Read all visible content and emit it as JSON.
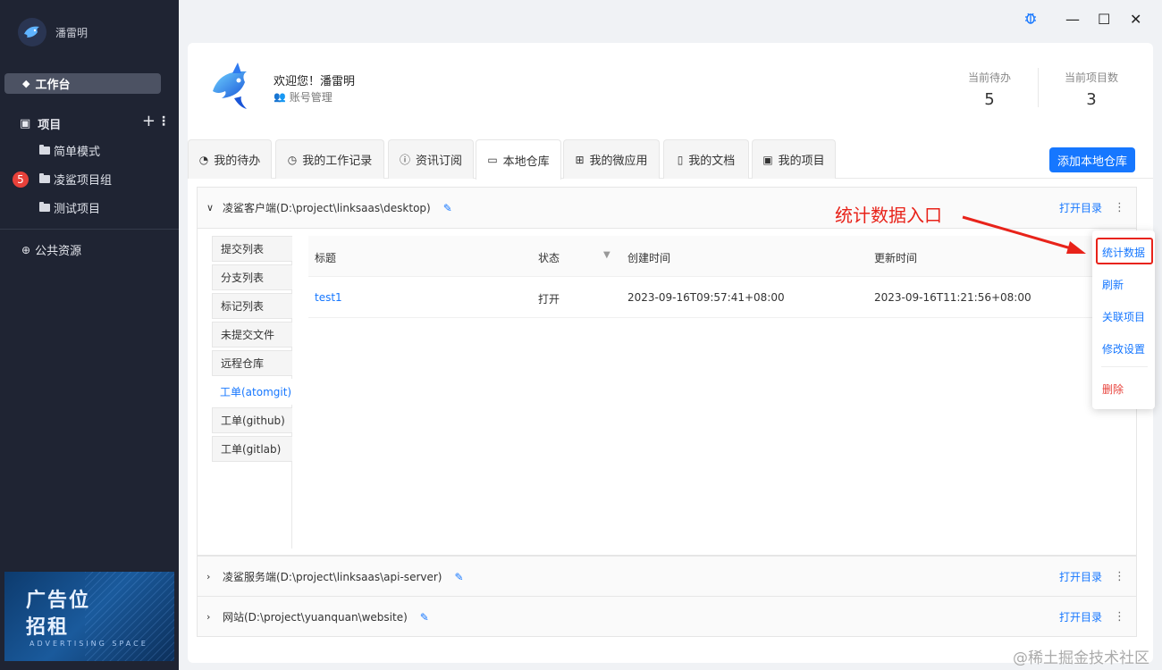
{
  "sidebar": {
    "username": "潘雷明",
    "workbench": "工作台",
    "projects_label": "项目",
    "add_symbol": "+",
    "more_symbol": "⋮",
    "projects": [
      {
        "name": "简单模式"
      },
      {
        "name": "凌鲨项目组",
        "badge": "5"
      },
      {
        "name": "测试项目"
      }
    ],
    "public_resources": "公共资源",
    "ad": {
      "line1": "广告位",
      "line2": "招租",
      "line3": "ADVERTISING SPACE"
    }
  },
  "titlebar": {
    "bug_icon": "bug-icon",
    "minimize": "—",
    "maximize": "☐",
    "close": "✕"
  },
  "welcome": {
    "greeting": "欢迎您！潘雷明",
    "account": "账号管理",
    "stats": [
      {
        "label": "当前待办",
        "value": "5"
      },
      {
        "label": "当前项目数",
        "value": "3"
      }
    ]
  },
  "tabs": [
    {
      "label": "我的待办",
      "icon": "clock-icon"
    },
    {
      "label": "我的工作记录",
      "icon": "history-icon"
    },
    {
      "label": "资讯订阅",
      "icon": "info-icon"
    },
    {
      "label": "本地仓库",
      "icon": "folder-icon",
      "active": true
    },
    {
      "label": "我的微应用",
      "icon": "grid-icon"
    },
    {
      "label": "我的文档",
      "icon": "doc-icon"
    },
    {
      "label": "我的项目",
      "icon": "project-icon"
    }
  ],
  "add_local_repo": "添加本地仓库",
  "repos": [
    {
      "name": "凌鲨客户端(D:\\project\\linksaas\\desktop)",
      "open_label": "打开目录",
      "expanded": true
    },
    {
      "name": "凌鲨服务端(D:\\project\\linksaas\\api-server)",
      "open_label": "打开目录",
      "expanded": false
    },
    {
      "name": "网站(D:\\project\\yuanquan\\website)",
      "open_label": "打开目录",
      "expanded": false
    }
  ],
  "subnav": [
    "提交列表",
    "分支列表",
    "标记列表",
    "未提交文件",
    "远程仓库",
    "工单(atomgit)",
    "工单(github)",
    "工单(gitlab)"
  ],
  "subnav_active": "工单(atomgit)",
  "table": {
    "headers": [
      "标题",
      "状态",
      "创建时间",
      "更新时间"
    ],
    "rows": [
      {
        "title": "test1",
        "status": "打开",
        "created": "2023-09-16T09:57:41+08:00",
        "updated": "2023-09-16T11:21:56+08:00"
      }
    ]
  },
  "annotation": "统计数据入口",
  "dropdown": {
    "items": [
      "统计数据",
      "刷新",
      "关联项目",
      "修改设置"
    ],
    "danger": "删除",
    "highlight_color": "#e8231a"
  },
  "watermark": "@稀土掘金技术社区",
  "colors": {
    "accent": "#1677ff",
    "sidebar": "#1f2433",
    "danger": "#e8413a"
  }
}
